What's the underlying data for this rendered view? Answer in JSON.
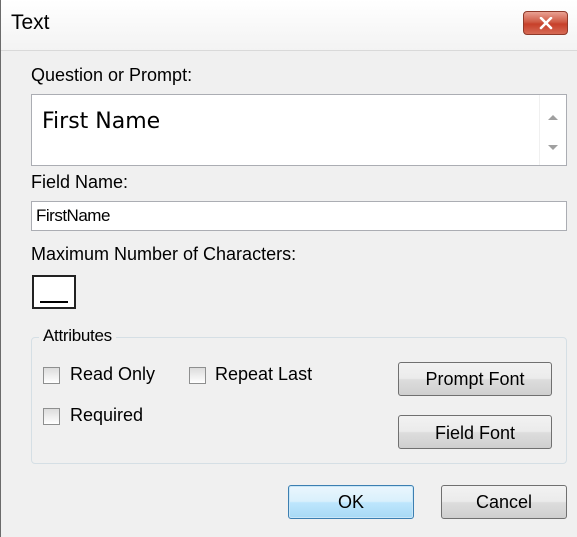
{
  "window": {
    "title": "Text"
  },
  "prompt": {
    "label": "Question or Prompt:",
    "value": "First Name"
  },
  "field_name": {
    "label": "Field Name:",
    "value": "FirstName"
  },
  "max_chars": {
    "label": "Maximum Number of Characters:",
    "value": ""
  },
  "attributes": {
    "legend": "Attributes",
    "read_only_label": "Read Only",
    "repeat_last_label": "Repeat Last",
    "required_label": "Required",
    "prompt_font_label": "Prompt Font",
    "field_font_label": "Field Font"
  },
  "buttons": {
    "ok_label": "OK",
    "cancel_label": "Cancel"
  },
  "icons": {
    "close": "close-icon",
    "scroll_up": "chevron-up-icon",
    "scroll_down": "chevron-down-icon"
  },
  "colors": {
    "close_button": "#c7402a",
    "default_button_border": "#3c7fb1",
    "dialog_background": "#f0f0f0"
  }
}
